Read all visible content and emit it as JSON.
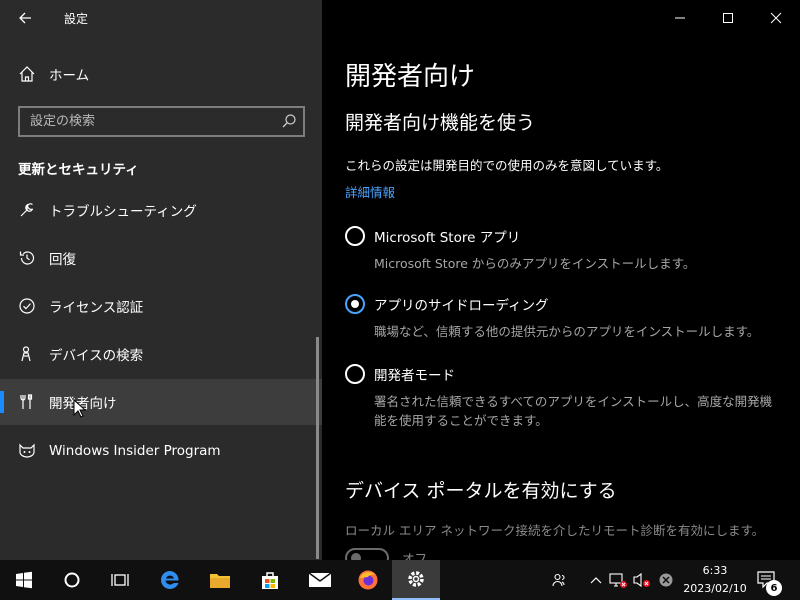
{
  "window": {
    "title": "設定",
    "controls": [
      "minimize",
      "maximize",
      "close"
    ]
  },
  "sidebar": {
    "home_label": "ホーム",
    "search": {
      "placeholder": "設定の検索",
      "value": ""
    },
    "section_heading": "更新とセキュリティ",
    "items": [
      {
        "label": "トラブルシューティング",
        "icon": "wrench-icon",
        "active": false
      },
      {
        "label": "回復",
        "icon": "recovery-icon",
        "active": false
      },
      {
        "label": "ライセンス認証",
        "icon": "check-circle-icon",
        "active": false
      },
      {
        "label": "デバイスの検索",
        "icon": "person-location-icon",
        "active": false
      },
      {
        "label": "開発者向け",
        "icon": "developer-tools-icon",
        "active": true
      },
      {
        "label": "Windows Insider Program",
        "icon": "insider-cat-icon",
        "active": false
      }
    ]
  },
  "main": {
    "page_title": "開発者向け",
    "subheading": "開発者向け機能を使う",
    "description": "これらの設定は開発目的での使用のみを意図しています。",
    "link": "詳細情報",
    "options": [
      {
        "label": "Microsoft Store アプリ",
        "desc": "Microsoft Store からのみアプリをインストールします。",
        "selected": false
      },
      {
        "label": "アプリのサイドローディング",
        "desc": "職場など、信頼する他の提供元からのアプリをインストールします。",
        "selected": true
      },
      {
        "label": "開発者モード",
        "desc": "署名された信頼できるすべてのアプリをインストールし、高度な開発機能を使用することができます。",
        "selected": false
      }
    ],
    "section2": {
      "heading": "デバイス ポータルを有効にする",
      "desc": "ローカル エリア ネットワーク接続を介したリモート診断を有効にします。",
      "toggle_label": "オフ",
      "toggle_on": false
    }
  },
  "taskbar": {
    "apps": [
      "start-icon",
      "cortana-icon",
      "task-view-icon",
      "edge-icon",
      "file-explorer-icon",
      "store-icon",
      "mail-icon",
      "firefox-icon",
      "settings-icon"
    ],
    "active_app": "settings-icon",
    "clock_time": "6:33",
    "clock_date": "2023/02/10",
    "notification_count": "6"
  },
  "colors": {
    "accent": "#1a8cff",
    "link": "#4aa3ff",
    "sidebar_bg": "#2b2b2b",
    "main_bg": "#000000",
    "taskbar_bg": "#101010"
  }
}
